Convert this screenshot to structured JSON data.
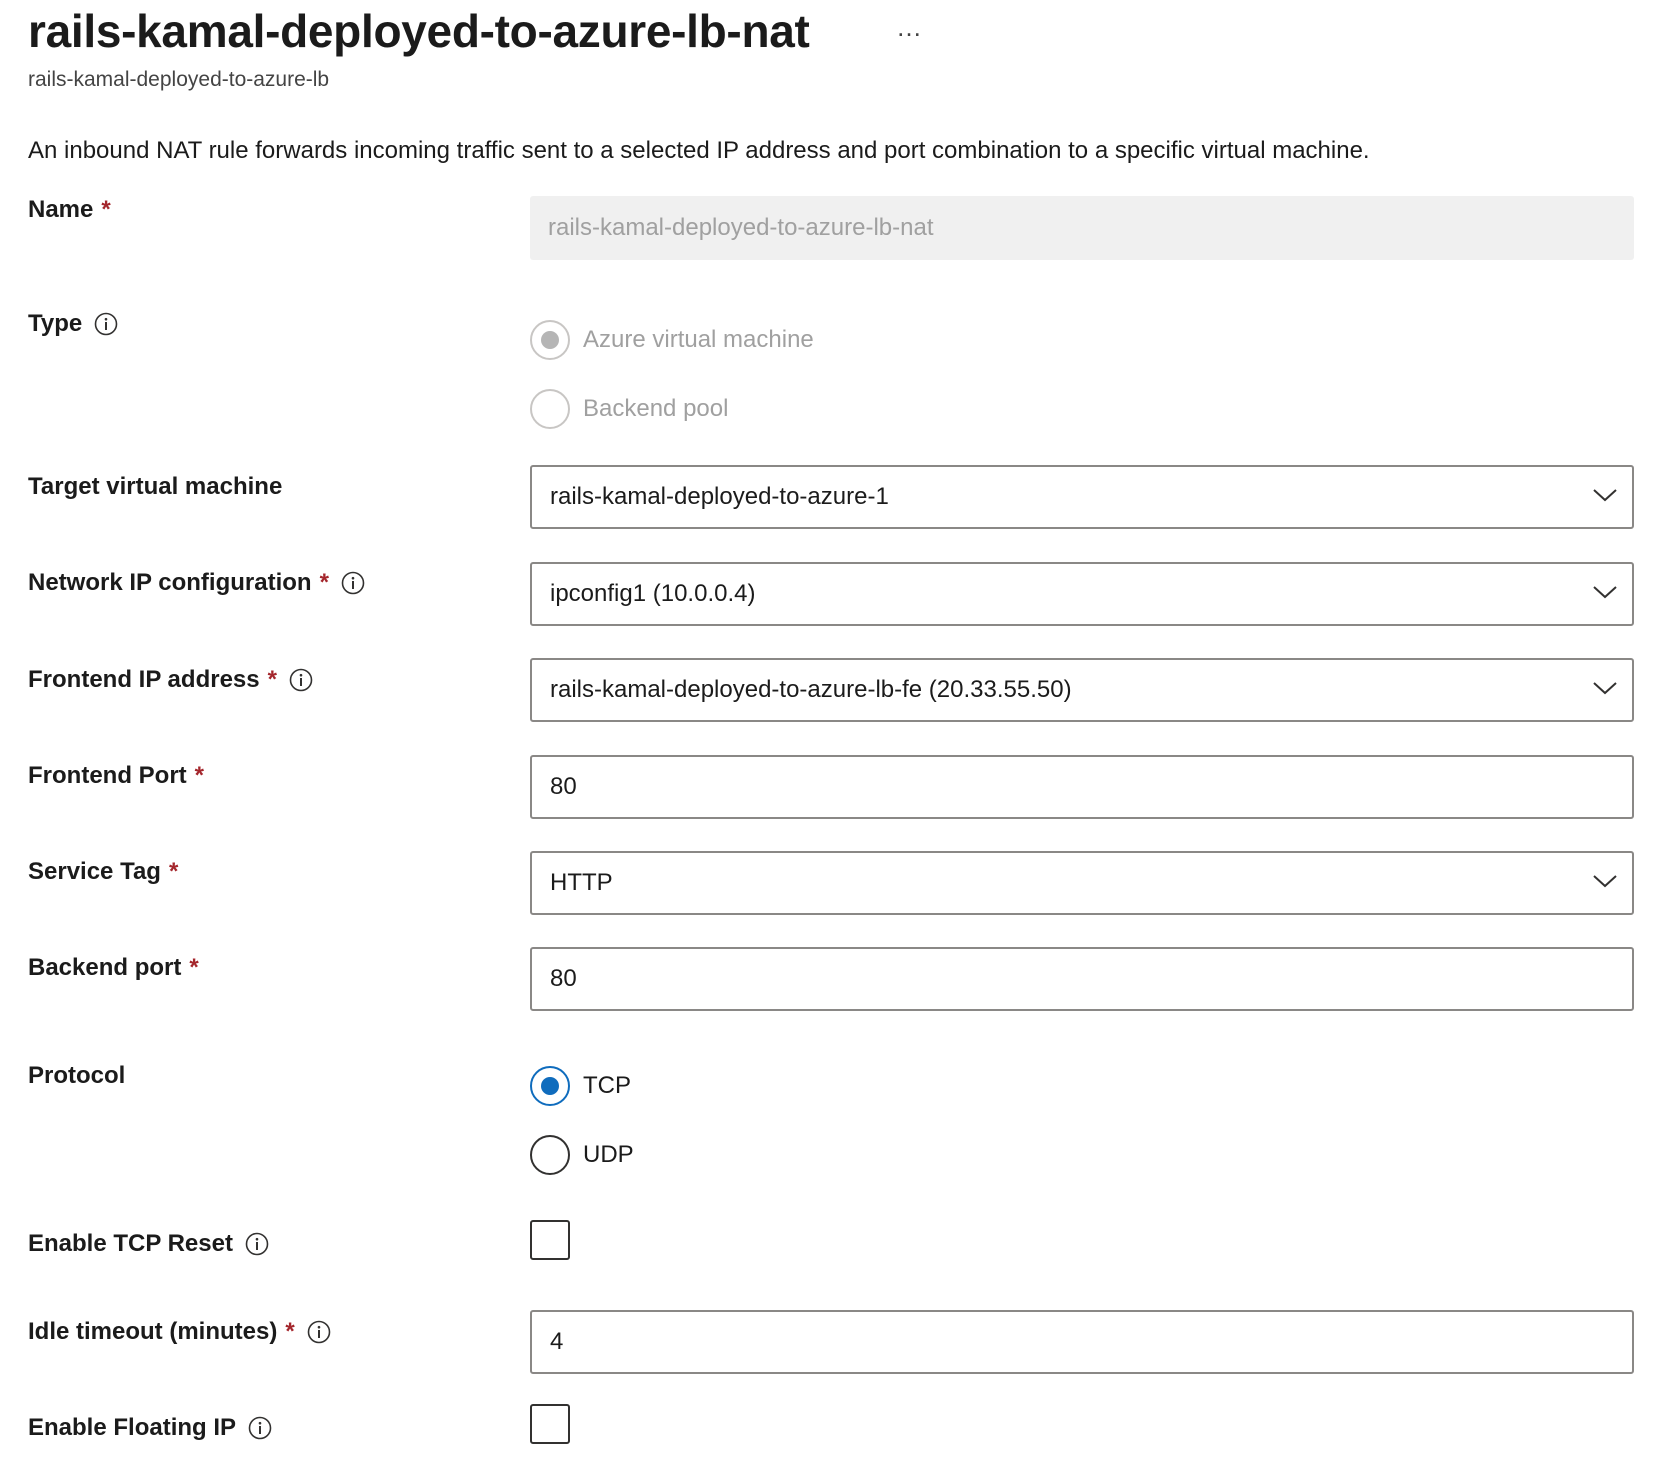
{
  "header": {
    "title": "rails-kamal-deployed-to-azure-lb-nat",
    "more_label": "…",
    "subtitle": "rails-kamal-deployed-to-azure-lb",
    "description": "An inbound NAT rule forwards incoming traffic sent to a selected IP address and port combination to a specific virtual machine."
  },
  "form": {
    "required_marker": "*",
    "name": {
      "label": "Name",
      "value": "rails-kamal-deployed-to-azure-lb-nat"
    },
    "type": {
      "label": "Type",
      "options": [
        "Azure virtual machine",
        "Backend pool"
      ],
      "selected": "Azure virtual machine"
    },
    "target_vm": {
      "label": "Target virtual machine",
      "value": "rails-kamal-deployed-to-azure-1"
    },
    "network_ip": {
      "label": "Network IP configuration",
      "value": "ipconfig1 (10.0.0.4)"
    },
    "frontend_ip": {
      "label": "Frontend IP address",
      "value": "rails-kamal-deployed-to-azure-lb-fe (20.33.55.50)"
    },
    "frontend_port": {
      "label": "Frontend Port",
      "value": "80"
    },
    "service_tag": {
      "label": "Service Tag",
      "value": "HTTP"
    },
    "backend_port": {
      "label": "Backend port",
      "value": "80"
    },
    "protocol": {
      "label": "Protocol",
      "options": [
        "TCP",
        "UDP"
      ],
      "selected": "TCP"
    },
    "tcp_reset": {
      "label": "Enable TCP Reset",
      "checked": false
    },
    "idle_timeout": {
      "label": "Idle timeout (minutes)",
      "value": "4"
    },
    "floating_ip": {
      "label": "Enable Floating IP",
      "checked": false
    }
  },
  "colors": {
    "required": "#a4262c",
    "accent": "#0f6cbd",
    "disabled_bg": "#f0f0f0"
  },
  "icons": [
    "info-icon",
    "chevron-down-icon",
    "more-icon"
  ]
}
